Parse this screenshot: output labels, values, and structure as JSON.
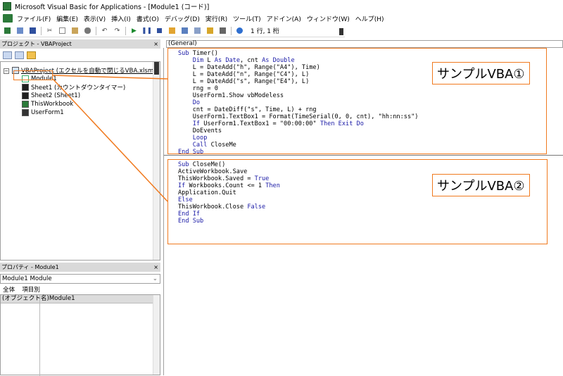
{
  "window": {
    "title": "Microsoft Visual Basic for Applications - [Module1 (コード)]"
  },
  "menu": [
    "ファイル(F)",
    "編集(E)",
    "表示(V)",
    "挿入(I)",
    "書式(O)",
    "デバッグ(D)",
    "実行(R)",
    "ツール(T)",
    "アドイン(A)",
    "ウィンドウ(W)",
    "ヘルプ(H)"
  ],
  "toolbar": {
    "position_text": "1 行, 1 桁"
  },
  "project_pane": {
    "title": "プロジェクト - VBAProject",
    "close": "×",
    "items": [
      {
        "label": "VBAProject (エクセルを自動で閉じるVBA.xlsm)",
        "icon": "project-icon"
      },
      {
        "label": "Module1",
        "icon": "module-icon"
      },
      {
        "label": "Sheet1 (カウントダウンタイマー)",
        "icon": "sheet-icon"
      },
      {
        "label": "Sheet2 (Sheet1)",
        "icon": "sheet-icon"
      },
      {
        "label": "ThisWorkbook",
        "icon": "workbook-icon"
      },
      {
        "label": "UserForm1",
        "icon": "userform-icon"
      }
    ]
  },
  "properties_pane": {
    "title": "プロパティ - Module1",
    "close": "×",
    "object_select": "Module1 Module",
    "tabs": [
      "全体",
      "項目別"
    ],
    "row_name": "(オブジェクト名)",
    "row_value": "Module1"
  },
  "code_pane": {
    "object_dropdown": "(General)",
    "block1": [
      [
        [
          "kw",
          "Sub"
        ],
        [
          "t",
          " Timer()"
        ]
      ],
      [
        [
          "t",
          "    "
        ],
        [
          "kw",
          "Dim"
        ],
        [
          "t",
          " L "
        ],
        [
          "kw",
          "As"
        ],
        [
          "t",
          " "
        ],
        [
          "kw",
          "Date"
        ],
        [
          "t",
          ", cnt "
        ],
        [
          "kw",
          "As"
        ],
        [
          "t",
          " "
        ],
        [
          "kw",
          "Double"
        ]
      ],
      [
        [
          "t",
          "    L = DateAdd(\"h\", Range(\"A4\"), Time)"
        ]
      ],
      [
        [
          "t",
          "    L = DateAdd(\"n\", Range(\"C4\"), L)"
        ]
      ],
      [
        [
          "t",
          "    L = DateAdd(\"s\", Range(\"E4\"), L)"
        ]
      ],
      [
        [
          "t",
          "    rng = 0"
        ]
      ],
      [
        [
          "t",
          "    UserForm1.Show vbModeless"
        ]
      ],
      [
        [
          "t",
          "    "
        ],
        [
          "kw",
          "Do"
        ]
      ],
      [
        [
          "t",
          "    cnt = DateDiff(\"s\", Time, L) + rng"
        ]
      ],
      [
        [
          "t",
          "    UserForm1.TextBox1 = Format(TimeSerial(0, 0, cnt), \"hh:nn:ss\")"
        ]
      ],
      [
        [
          "t",
          "    "
        ],
        [
          "kw",
          "If"
        ],
        [
          "t",
          " UserForm1.TextBox1 = \"00:00:00\" "
        ],
        [
          "kw",
          "Then Exit Do"
        ]
      ],
      [
        [
          "t",
          "    DoEvents"
        ]
      ],
      [
        [
          "t",
          "    "
        ],
        [
          "kw",
          "Loop"
        ]
      ],
      [
        [
          "t",
          "    "
        ],
        [
          "kw",
          "Call"
        ],
        [
          "t",
          " CloseMe"
        ]
      ],
      [
        [
          "kw",
          "End Sub"
        ]
      ]
    ],
    "block2": [
      [
        [
          "kw",
          "Sub"
        ],
        [
          "t",
          " CloseMe()"
        ]
      ],
      [
        [
          "t",
          "ActiveWorkbook.Save"
        ]
      ],
      [
        [
          "t",
          "ThisWorkbook.Saved = "
        ],
        [
          "kw",
          "True"
        ]
      ],
      [
        [
          "kw",
          "If"
        ],
        [
          "t",
          " Workbooks.Count <= 1 "
        ],
        [
          "kw",
          "Then"
        ]
      ],
      [
        [
          "t",
          "Application.Quit"
        ]
      ],
      [
        [
          "kw",
          "Else"
        ]
      ],
      [
        [
          "t",
          "ThisWorkbook.Close "
        ],
        [
          "kw",
          "False"
        ]
      ],
      [
        [
          "kw",
          "End If"
        ]
      ],
      [
        [
          "kw",
          "End Sub"
        ]
      ]
    ]
  },
  "annotations": {
    "label1": "サンプルVBA①",
    "label2": "サンプルVBA②"
  },
  "colors": {
    "annotation": "#f07a1f",
    "keyword": "#1a1aa6"
  }
}
